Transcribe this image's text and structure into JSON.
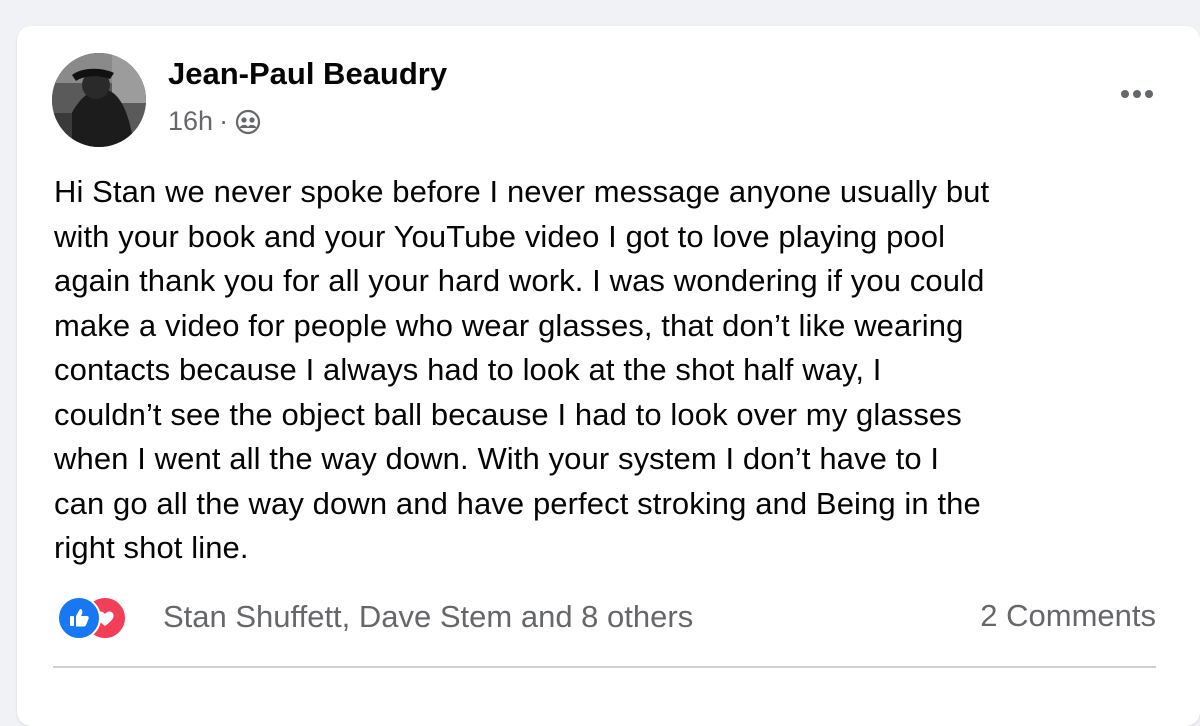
{
  "post": {
    "author": "Jean-Paul Beaudry",
    "time": "16h",
    "separator": "·",
    "audience_icon": "friends-icon",
    "more_icon": "more-options-icon",
    "text_lines": [
      "Hi Stan we never spoke before I never message anyone usually but",
      "with your book and your YouTube video I got to love playing pool",
      "again thank you for all your hard work. I was wondering if you could",
      "make a video for people who wear glasses, that don’t like wearing",
      "contacts because I always had to look at the shot half way, I",
      "couldn’t see the object ball because I had to look over my glasses",
      "when I went all the way down. With your system I don’t have to I",
      "can go all the way down and have perfect stroking and Being in the",
      "right shot line."
    ]
  },
  "reactions": {
    "icons": [
      "like-icon",
      "love-icon"
    ],
    "names": "Stan Shuffett, Dave Stem and 8 others"
  },
  "comments": {
    "label": "2 Comments"
  },
  "colors": {
    "like": "#1877f2",
    "love": "#f33e58",
    "secondary_text": "#65676b",
    "primary_text": "#050505",
    "background": "#f0f2f5"
  }
}
